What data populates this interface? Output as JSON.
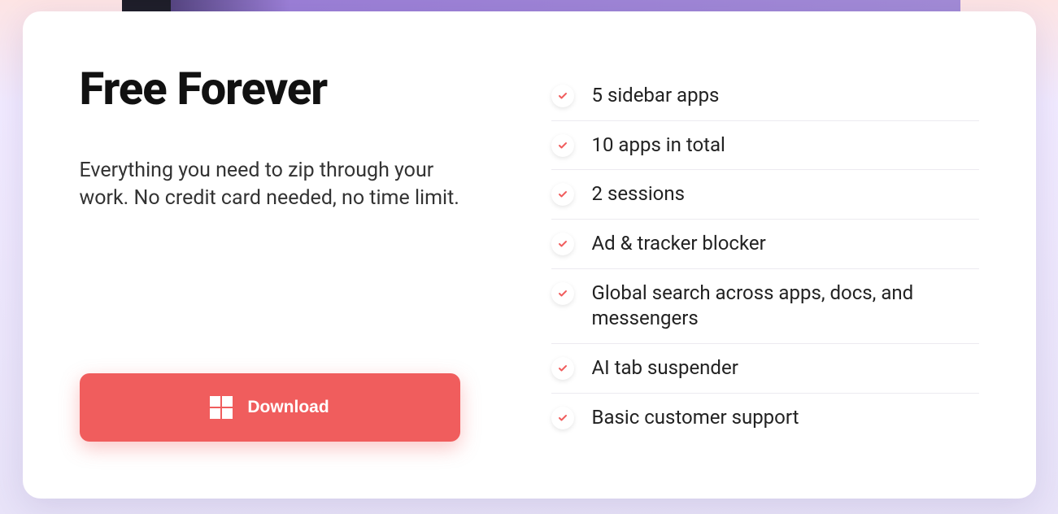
{
  "colors": {
    "accent": "#f05d5d",
    "text": "#111111",
    "subtext": "#333333"
  },
  "title": "Free Forever",
  "subtitle": "Everything you need to zip through your work. No credit card needed, no time limit.",
  "download_label": "Download",
  "features": [
    "5 sidebar apps",
    "10 apps in total",
    "2 sessions",
    "Ad & tracker blocker",
    "Global search across apps, docs, and messengers",
    "AI tab suspender",
    "Basic customer support"
  ]
}
